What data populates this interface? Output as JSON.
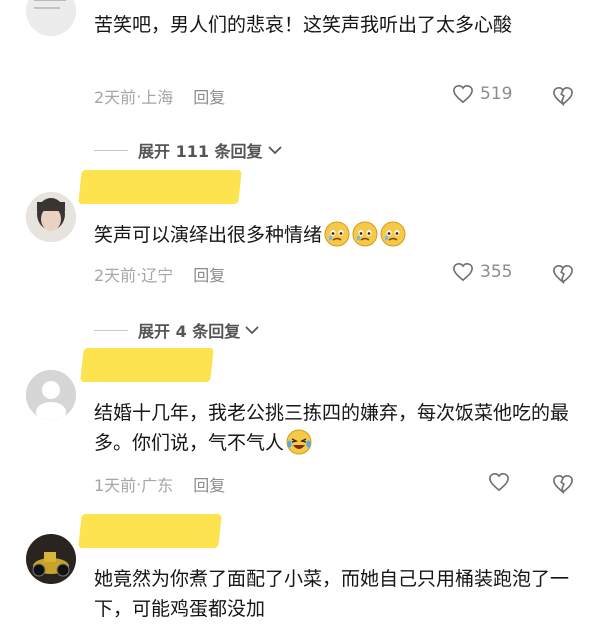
{
  "comments": [
    {
      "text": "苦笑吧，男人们的悲哀！这笑声我听出了太多心酸",
      "time": "2天前",
      "location": "上海",
      "reply": "回复",
      "likes": "519"
    },
    {
      "text": "笑声可以演绎出很多种情绪",
      "emoji": [
        "crying-face",
        "crying-face",
        "crying-face"
      ],
      "time": "2天前",
      "location": "辽宁",
      "reply": "回复",
      "likes": "355"
    },
    {
      "text": "结婚十几年，我老公挑三拣四的嫌弃，每次饭菜他吃的最多。你们说，气不气人",
      "emoji": [
        "laughing-tears-face"
      ],
      "time": "1天前",
      "location": "广东",
      "reply": "回复"
    },
    {
      "text": "她竟然为你煮了面配了小菜，而她自己只用桶装跑泡了一下，可能鸡蛋都没加"
    }
  ],
  "expand_1": "展开 111 条回复",
  "expand_2": "展开 4 条回复",
  "separator": " · ",
  "colors": {
    "redaction": "#fde34d",
    "meta": "#a6a6a6"
  }
}
